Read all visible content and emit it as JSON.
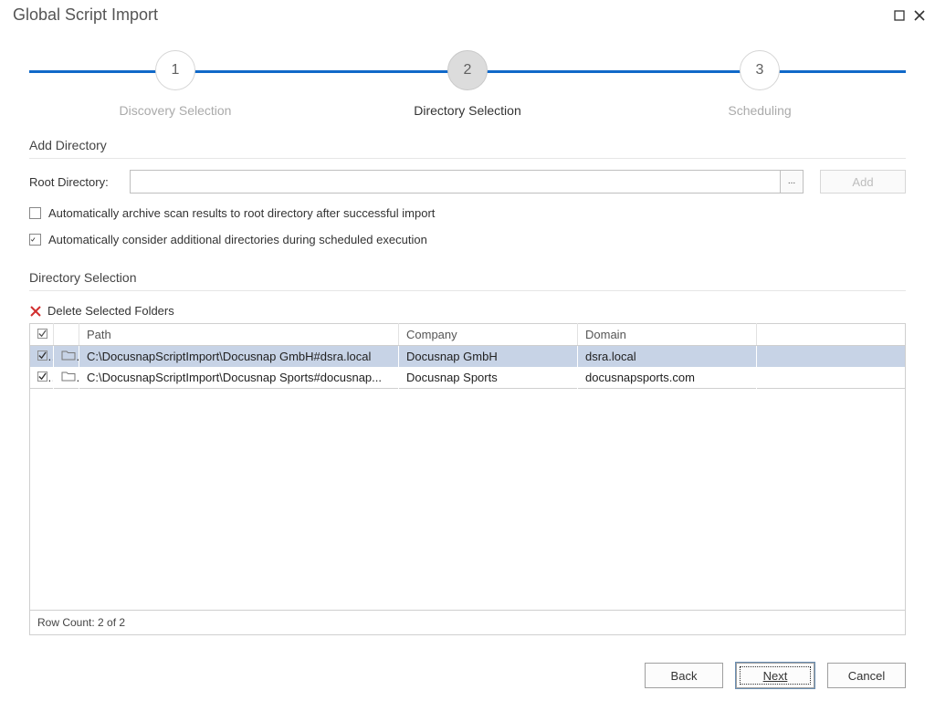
{
  "window": {
    "title": "Global Script Import"
  },
  "wizard": {
    "steps": [
      {
        "num": "1",
        "label": "Discovery Selection",
        "active": false
      },
      {
        "num": "2",
        "label": "Directory Selection",
        "active": true
      },
      {
        "num": "3",
        "label": "Scheduling",
        "active": false
      }
    ]
  },
  "addDirectory": {
    "heading": "Add Directory",
    "rootLabel": "Root Directory:",
    "rootValue": "",
    "browseLabel": "...",
    "addLabel": "Add",
    "archive": {
      "checked": false,
      "label": "Automatically archive scan results to root directory after successful import"
    },
    "consider": {
      "checked": true,
      "label": "Automatically consider additional directories during scheduled execution"
    }
  },
  "directorySelection": {
    "heading": "Directory Selection",
    "deleteLabel": "Delete Selected Folders",
    "columns": {
      "path": "Path",
      "company": "Company",
      "domain": "Domain"
    },
    "headerSelectAllChecked": true,
    "rows": [
      {
        "checked": true,
        "path": "C:\\DocusnapScriptImport\\Docusnap GmbH#dsra.local",
        "company": "Docusnap GmbH",
        "domain": "dsra.local",
        "selected": true
      },
      {
        "checked": true,
        "path": "C:\\DocusnapScriptImport\\Docusnap Sports#docusnap...",
        "company": "Docusnap Sports",
        "domain": "docusnapsports.com",
        "selected": false
      }
    ],
    "footer": "Row Count: 2 of 2"
  },
  "buttons": {
    "back": "Back",
    "next": "Next",
    "cancel": "Cancel"
  }
}
